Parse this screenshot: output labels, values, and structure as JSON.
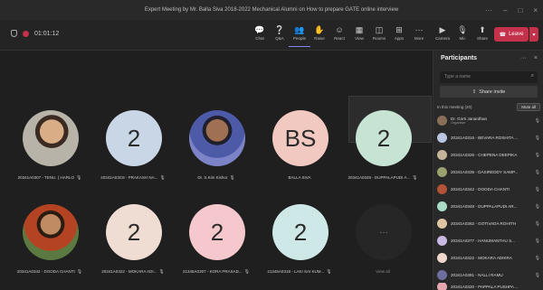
{
  "window": {
    "title": "Expert Meeting by Mr. Balla Siva 2018-2022 Mechanical Alumni on How to prepare GATE online interview",
    "controls": [
      "···",
      "–",
      "□",
      "×"
    ]
  },
  "toolbar": {
    "timer": "01:01:12",
    "buttons": [
      {
        "label": "Chat",
        "icon": "💬"
      },
      {
        "label": "Q&A",
        "icon": "❔"
      },
      {
        "label": "People",
        "icon": "👥",
        "active": true
      },
      {
        "label": "Raise",
        "icon": "✋"
      },
      {
        "label": "React",
        "icon": "☺"
      },
      {
        "label": "View",
        "icon": "▦"
      },
      {
        "label": "Rooms",
        "icon": "◫"
      },
      {
        "label": "Apps",
        "icon": "⊞"
      },
      {
        "label": "More",
        "icon": "···"
      },
      {
        "label": "Camera",
        "icon": "▶"
      },
      {
        "label": "Mic",
        "icon": "🎙"
      },
      {
        "label": "Share",
        "icon": "⬆"
      }
    ],
    "leave_label": "Leave",
    "leave_icon": "☎",
    "leave_caret": "▾",
    "colors": {
      "leave": "#c4314b",
      "accent": "#7f85f5"
    }
  },
  "stage": {
    "tiles": [
      {
        "initials": "",
        "photo": "photo1",
        "label": "20341A0307 - TENU. ( HARLO",
        "mic": "🎙"
      },
      {
        "initials": "2",
        "bg": "#c8d6e6",
        "label": "20341A03C8 - PRAKASH NA...",
        "mic": "🎙"
      },
      {
        "initials": "",
        "photo": "photo2",
        "label": "Dr. S.Kim Kishor",
        "mic": "🎙"
      },
      {
        "initials": "BS",
        "bg": "#f2c9c1",
        "label": "BALLA SIVA",
        "mic": ""
      },
      {
        "initials": "2",
        "bg": "#c7e3d3",
        "label": "20341A0348 - DUPPALAPUDI A...",
        "mic": "🎙"
      },
      {
        "initials": "",
        "photo": "photo3",
        "label": "20341A0342 - DOODA CHANTI",
        "mic": "🎙"
      },
      {
        "initials": "2",
        "bg": "#efdcd2",
        "label": "20341A0322 - MOKARA ADI...",
        "mic": "🎙"
      },
      {
        "initials": "2",
        "bg": "#f4c8cc",
        "label": "21345A0307 - KORA PRASAD...",
        "mic": "🎙"
      },
      {
        "initials": "2",
        "bg": "#cde8e6",
        "label": "21345A0318 - LAKI SAI KUM...",
        "mic": "🎙"
      },
      {
        "initials": "···",
        "bg": "#262626",
        "label": "View all",
        "mic": ""
      }
    ]
  },
  "panel": {
    "title": "Participants",
    "actions": [
      "···",
      "×"
    ],
    "search_placeholder": "Type a name",
    "search_icon": "⌕",
    "share_invite": "Share invite",
    "share_icon": "⇪",
    "section": "In this meeting (20)",
    "mute_all": "Mute all",
    "participants": [
      {
        "name": "Dr. Gorti Janardhan",
        "sub": "Organiser",
        "color": "#8a6f58"
      },
      {
        "name": "20341A0315 - BEVARA ROSHITA ...",
        "color": "#b8c6e2"
      },
      {
        "name": "20341A0326 - CHEPENA DEEPIKA",
        "color": "#c6b49a"
      },
      {
        "name": "20341A0335 - DASIREDDY SAMP...",
        "color": "#9aa06e"
      },
      {
        "name": "20341A0342 - DOODA CHANTI",
        "color": "#b25236"
      },
      {
        "name": "20341A0348 - DUPPALAPUDI AR...",
        "color": "#a9dcc4"
      },
      {
        "name": "20341A0362 - GOTIVADA ROHITH",
        "color": "#e0c5a3"
      },
      {
        "name": "20341A0377 - HANUMANTHU S...",
        "color": "#c9b8e0"
      },
      {
        "name": "20341A0322 - MOKARA ADIKRA",
        "color": "#f0d8cc"
      },
      {
        "name": "20341A0381 - NALLI RAMU",
        "color": "#6e6ea0"
      },
      {
        "name": "20341A0320 - PAPPALA PUSHPA ...",
        "color": "#e6a8b0"
      }
    ],
    "mic_icon": "🎙"
  }
}
